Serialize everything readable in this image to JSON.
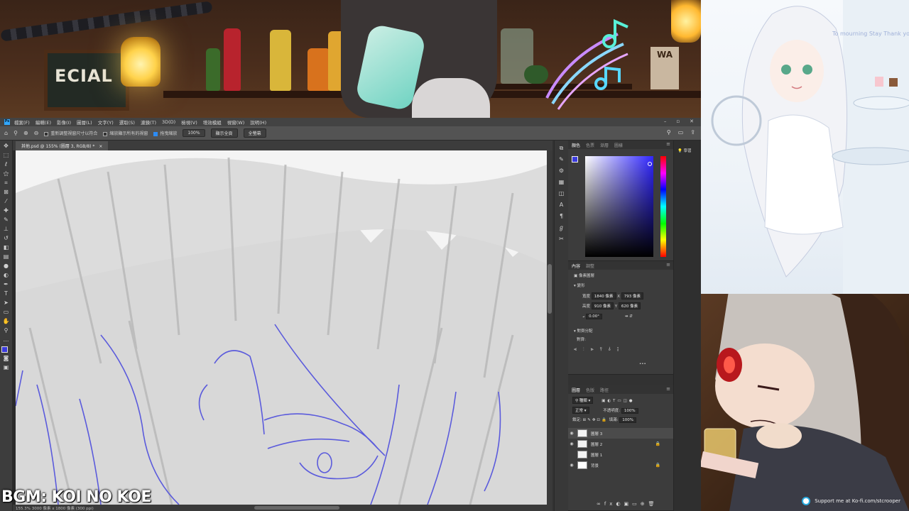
{
  "photoshop": {
    "menu": [
      "檔案(F)",
      "編輯(E)",
      "影像(I)",
      "圖層(L)",
      "文字(Y)",
      "選取(S)",
      "濾鏡(T)",
      "3D(D)",
      "檢視(V)",
      "增效模組",
      "視窗(W)",
      "說明(H)"
    ],
    "options": {
      "resize_windows_label": "重新調整視窗尺寸以符合",
      "zoom_all_windows_label": "縮放顯示所有的視窗",
      "scrubby_zoom_label": "拖曳縮放",
      "zoom_value": "100%",
      "fit_screen_label": "顯示全頁",
      "fill_screen_label": "全螢幕"
    },
    "document_tab": "其他.psd @ 155% (圖層 3, RGB/8) *",
    "status_text": "155.3%    3000 像素 x 1800 像素 (300 ppi)",
    "color_panel": {
      "tabs": [
        "顏色",
        "色票",
        "漸層",
        "圖樣"
      ],
      "foreground_color": "#3b3bdd"
    },
    "properties_panel": {
      "tabs": [
        "內容",
        "調整"
      ],
      "layer_kind": "像素圖層",
      "transform_title": "變形",
      "width_label": "寬度",
      "width_value": "1840 像素",
      "height_label": "高度",
      "height_value": "910 像素",
      "x_label": "X",
      "x_value": "793 像素",
      "y_label": "Y",
      "y_value": "620 像素",
      "angle_value": "0.00°",
      "align_title": "對齊分配",
      "align_sub": "對齊:"
    },
    "layers_panel": {
      "tabs": [
        "圖層",
        "色版",
        "路徑"
      ],
      "kind_filter": "種類",
      "blend_mode": "正常",
      "opacity_label": "不透明度:",
      "opacity_value": "100%",
      "lock_label": "鎖定:",
      "fill_label": "填滿:",
      "fill_value": "100%",
      "layers": [
        {
          "name": "圖層 3",
          "visible": true,
          "selected": true
        },
        {
          "name": "圖層 2",
          "visible": true,
          "selected": false
        },
        {
          "name": "圖層 1",
          "visible": false,
          "selected": false
        },
        {
          "name": "背景",
          "visible": true,
          "selected": false
        }
      ]
    },
    "learn_label": "學習"
  },
  "overlay": {
    "bar_sign": "ECIAL",
    "wall_sign": "WA",
    "art_note": "To mourning Stay Thank you I'm Sei",
    "kofi_text": "Support me at Ko-fi.com/stcrooper",
    "bgm_text": "BGM: KOI NO KOE"
  }
}
